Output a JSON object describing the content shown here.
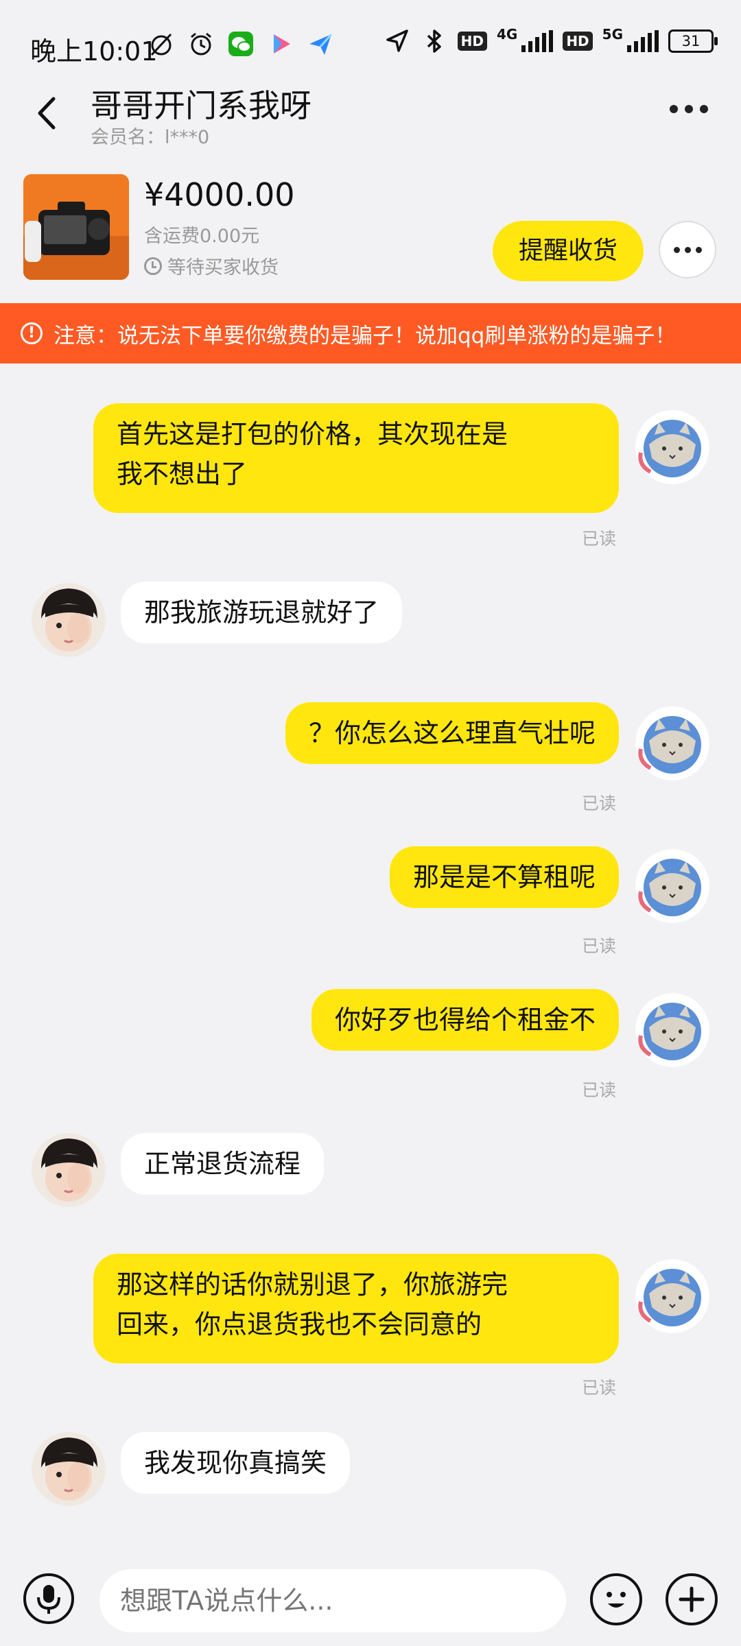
{
  "status_bar": {
    "time": "晚上10:01",
    "battery": "31",
    "network_1": "4G",
    "network_2": "5G",
    "hd_label": "HD"
  },
  "header": {
    "title": "哥哥开门系我呀",
    "member": "会员名：l***0"
  },
  "product": {
    "price": "¥4000.00",
    "shipping": "含运费0.00元",
    "status": "等待买家收货",
    "remind_button": "提醒收货"
  },
  "warning": {
    "text": "注意：说无法下单要你缴费的是骗子！说加qq刷单涨粉的是骗子！"
  },
  "messages": [
    {
      "from": "me",
      "text_lines": [
        "首先这是打包的价格，其次现在是",
        "我不想出了"
      ],
      "status": "已读"
    },
    {
      "from": "them",
      "text": "那我旅游玩退就好了"
    },
    {
      "from": "me",
      "text": "？你怎么这么理直气壮呢",
      "status": "已读"
    },
    {
      "from": "me",
      "text": "那是是不算租呢",
      "status": "已读"
    },
    {
      "from": "me",
      "text": "你好歹也得给个租金不",
      "status": "已读"
    },
    {
      "from": "them",
      "text": "正常退货流程"
    },
    {
      "from": "me",
      "text_lines": [
        "那这样的话你就别退了，你旅游完",
        "回来，你点退货我也不会同意的"
      ],
      "status": "已读"
    },
    {
      "from": "them",
      "text": "我发现你真搞笑"
    }
  ],
  "input": {
    "placeholder": "想跟TA说点什么..."
  },
  "colors": {
    "my_bubble": "#ffe60f",
    "their_bubble": "#ffffff",
    "warning_bg": "#ff5a24",
    "background": "#f2f2f4"
  }
}
